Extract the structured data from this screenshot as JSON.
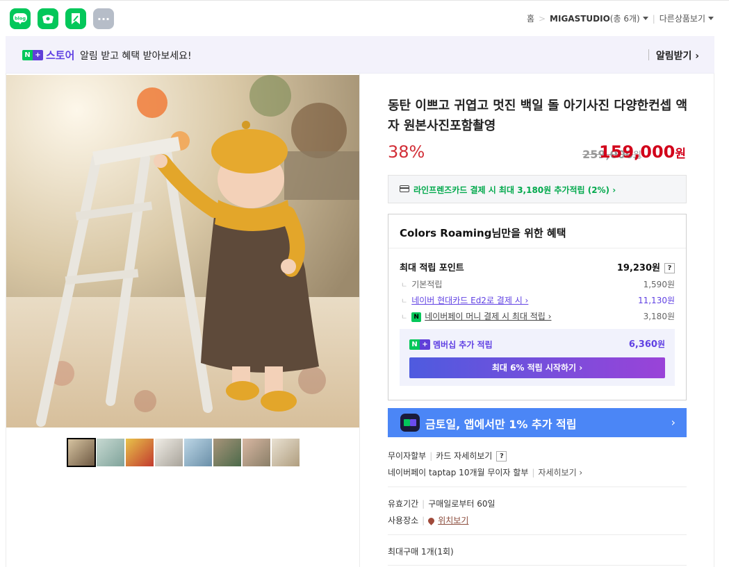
{
  "sns": [
    {
      "name": "blog",
      "label": "blog",
      "color": "#03c75a"
    },
    {
      "name": "cafe",
      "label": "",
      "color": "#03c75a"
    },
    {
      "name": "kkeep",
      "label": "",
      "color": "#03c75a"
    },
    {
      "name": "more",
      "label": "···",
      "color": "#b6bdc8"
    }
  ],
  "topnav": {
    "home": "홈",
    "store_name": "MIGASTUDIO",
    "store_count": "(총 6개)",
    "other_products": "다른상품보기"
  },
  "banner": {
    "store_label": "스토어",
    "message": "알림 받고 혜택 받아보세요!",
    "alarm_button": "알림받기 ›"
  },
  "product": {
    "title": "동탄 이쁘고 귀엽고 멋진 백일 돌 아기사진 다양한컨셉 액자 원본사진포함촬영",
    "discount": "38%",
    "original_price": "259,000",
    "original_unit": "원",
    "price": "159,000",
    "price_unit": "원",
    "thumbnails": 8
  },
  "card_promo": "라인프렌즈카드 결제 시 최대 3,180원 추가적립 (2%) ›",
  "benefit": {
    "heading": "Colors Roaming님만을 위한 혜택",
    "max_points_label": "최대 적립 포인트",
    "max_points_value": "19,230원",
    "help": "?",
    "rows": [
      {
        "label": "기본적립",
        "value": "1,590원"
      },
      {
        "label": "네이버 현대카드 Ed2로 결제 시 ›",
        "value": "11,130원"
      },
      {
        "label": "네이버페이 머니 결제 시 최대 적립 ›",
        "value": "3,180원"
      }
    ],
    "membership_label": "멤버십 추가 적립",
    "membership_value": "6,360",
    "membership_unit": "원",
    "membership_button": "최대 6% 적립 시작하기 ›"
  },
  "promo_banner": {
    "text": "금토일, 앱에서만 1% 추가 적립",
    "arrow": "›"
  },
  "info": {
    "installment": "무이자할부",
    "card_detail": "카드 자세히보기",
    "npay_installment": "네이버페이 taptap 10개월 무이자 할부",
    "detail_link": "자세히보기 ›",
    "validity_label": "유효기간",
    "validity_value": "구매일로부터 60일",
    "place_label": "사용장소",
    "place_link": "위치보기",
    "max_purchase": "최대구매 1개(1회)"
  },
  "colors": {
    "naver_green": "#03c75a",
    "naver_purple": "#6041e3",
    "price_red": "#d2001a",
    "promo_blue": "#4b86f6"
  }
}
